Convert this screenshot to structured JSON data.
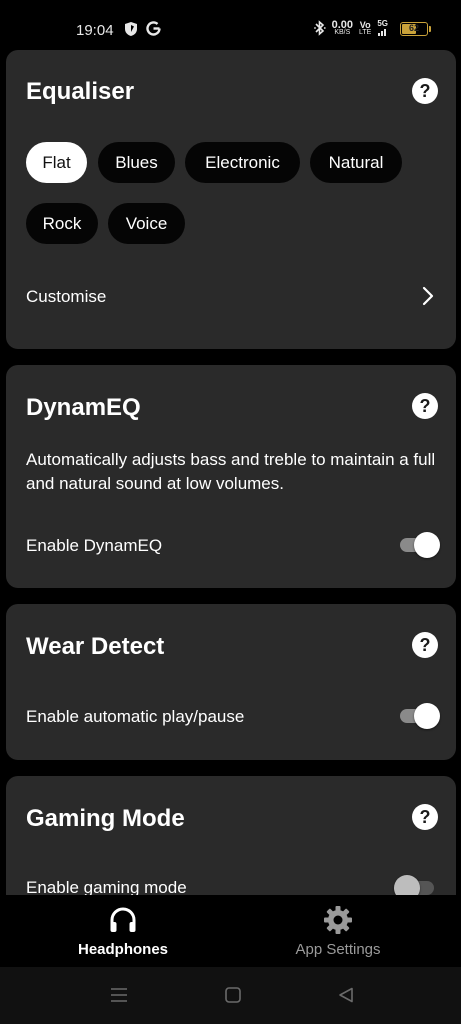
{
  "status_bar": {
    "time": "19:04",
    "net_speed_value": "0.00",
    "net_speed_unit": "KB/S",
    "volte_top": "Vo",
    "volte_bottom": "LTE",
    "network_type": "5G",
    "battery_level": "62",
    "battery_color": "#c9a23a"
  },
  "equaliser": {
    "title": "Equaliser",
    "help": "?",
    "presets": [
      "Flat",
      "Blues",
      "Electronic",
      "Natural",
      "Rock",
      "Voice"
    ],
    "selected": "Flat",
    "customise_label": "Customise"
  },
  "dynameq": {
    "title": "DynamEQ",
    "help": "?",
    "description": "Automatically adjusts bass and treble to maintain a full and natural sound at low volumes.",
    "toggle_label": "Enable DynamEQ",
    "enabled": true
  },
  "wear_detect": {
    "title": "Wear Detect",
    "help": "?",
    "toggle_label": "Enable automatic play/pause",
    "enabled": true
  },
  "gaming_mode": {
    "title": "Gaming Mode",
    "help": "?",
    "toggle_label": "Enable gaming mode",
    "enabled": false
  },
  "bottom_nav": {
    "items": [
      {
        "label": "Headphones",
        "icon": "headphones-icon",
        "active": true
      },
      {
        "label": "App Settings",
        "icon": "gear-icon",
        "active": false
      }
    ],
    "active_color": "#ffffff",
    "inactive_color": "#9a9a9a"
  },
  "system_nav": {
    "icons": [
      "menu-icon",
      "home-icon",
      "back-icon"
    ]
  }
}
